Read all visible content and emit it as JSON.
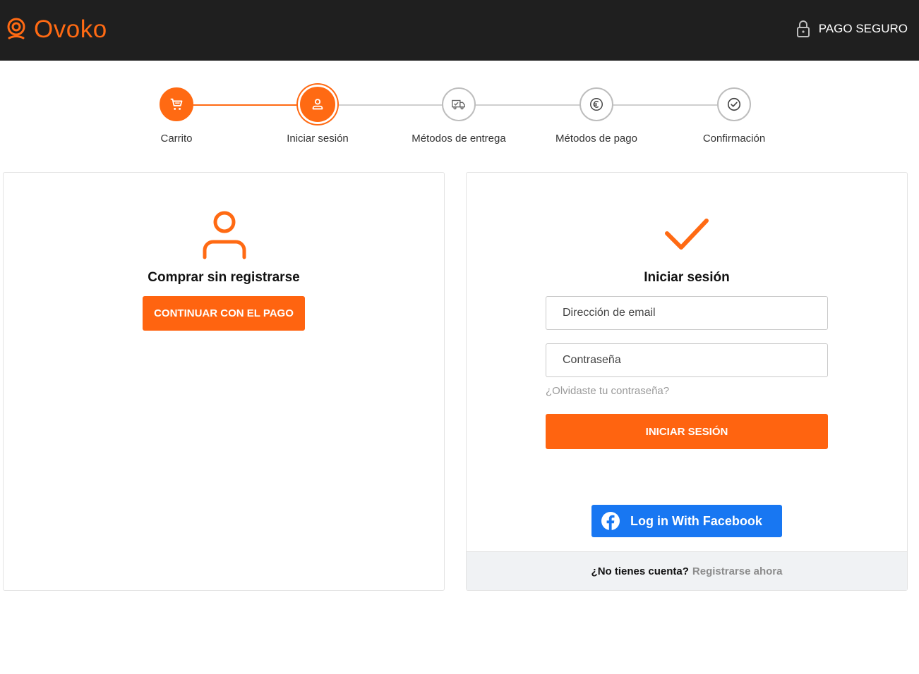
{
  "brand": {
    "name": "Ovoko",
    "accent": "#ff6a13"
  },
  "header": {
    "secure_label": "PAGO SEGURO",
    "secure_icon": "lock-icon"
  },
  "stepper": {
    "steps": [
      {
        "label": "Carrito",
        "icon": "cart-icon",
        "state": "done"
      },
      {
        "label": "Iniciar sesión",
        "icon": "user-icon",
        "state": "active"
      },
      {
        "label": "Métodos de entrega",
        "icon": "truck-icon",
        "state": "pending"
      },
      {
        "label": "Métodos de pago",
        "icon": "euro-icon",
        "state": "pending"
      },
      {
        "label": "Confirmación",
        "icon": "check-circle-icon",
        "state": "pending"
      }
    ]
  },
  "guest": {
    "title": "Comprar sin registrarse",
    "button_label": "CONTINUAR CON EL PAGO"
  },
  "login": {
    "title": "Iniciar sesión",
    "email_placeholder": "Dirección de email",
    "password_placeholder": "Contraseña",
    "forgot_label": "¿Olvidaste tu contraseña?",
    "submit_label": "INICIAR SESIÓN",
    "facebook_label": "Log in With Facebook",
    "footer_question": "¿No tienes cuenta?",
    "footer_link": "Registrarse ahora"
  }
}
